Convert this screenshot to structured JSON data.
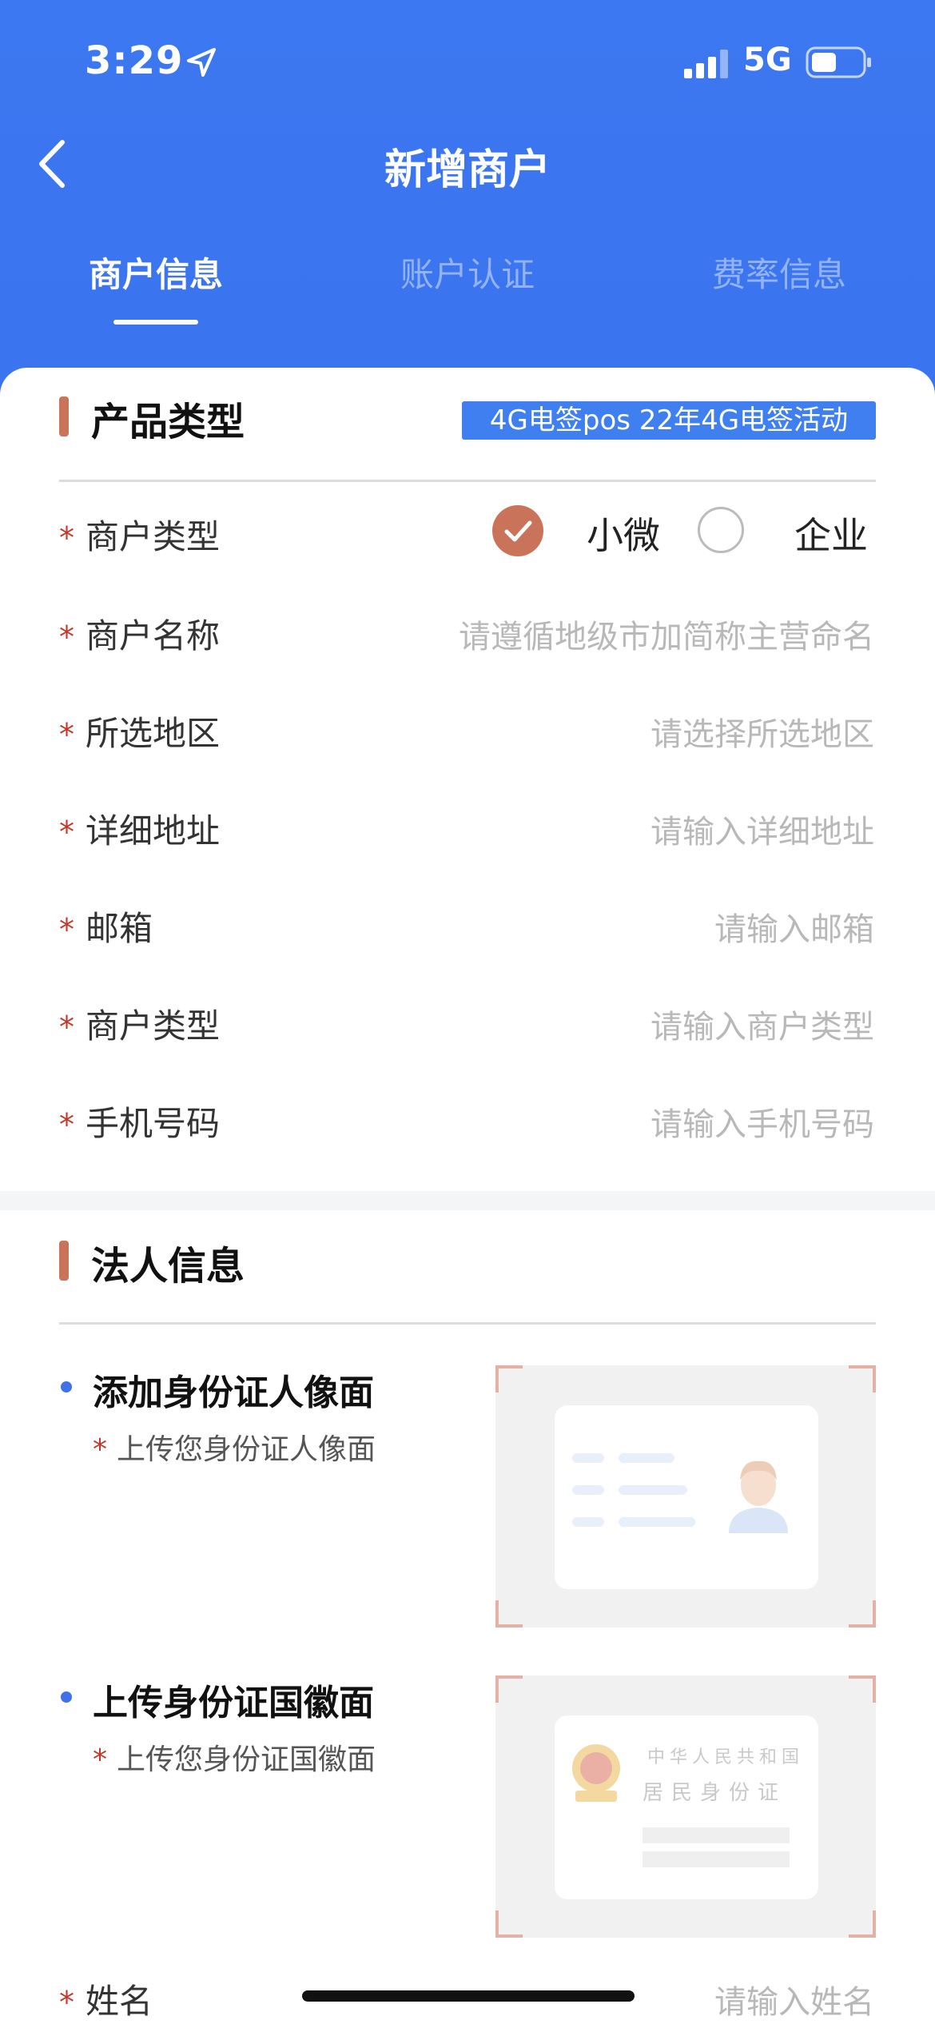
{
  "status_bar": {
    "time": "3:29",
    "network": "5G"
  },
  "nav": {
    "title": "新增商户"
  },
  "tabs": [
    {
      "label": "商户信息"
    },
    {
      "label": "账户认证"
    },
    {
      "label": "费率信息"
    }
  ],
  "product_section": {
    "title": "产品类型",
    "tag": "4G电签pos 22年4G电签活动"
  },
  "merchant_type_radio": {
    "label": "商户类型",
    "options": [
      {
        "label": "小微",
        "checked": true
      },
      {
        "label": "企业",
        "checked": false
      }
    ]
  },
  "fields": [
    {
      "label": "商户名称",
      "placeholder": "请遵循地级市加简称主营命名"
    },
    {
      "label": "所选地区",
      "placeholder": "请选择所选地区"
    },
    {
      "label": "详细地址",
      "placeholder": "请输入详细地址"
    },
    {
      "label": "邮箱",
      "placeholder": "请输入邮箱"
    },
    {
      "label": "商户类型",
      "placeholder": "请输入商户类型"
    },
    {
      "label": "手机号码",
      "placeholder": "请输入手机号码"
    }
  ],
  "legal_section": {
    "title": "法人信息",
    "upload_front": {
      "title": "添加身份证人像面",
      "sub": "上传您身份证人像面"
    },
    "upload_back": {
      "title": "上传身份证国徽面",
      "sub": "上传您身份证国徽面",
      "card_line1": "中华人民共和国",
      "card_line2": "居民身份证"
    },
    "name_field": {
      "label": "姓名",
      "placeholder": "请输入姓名"
    }
  },
  "colors": {
    "primary": "#3c78f1",
    "accent": "#c9735a",
    "required": "#c0392b"
  }
}
